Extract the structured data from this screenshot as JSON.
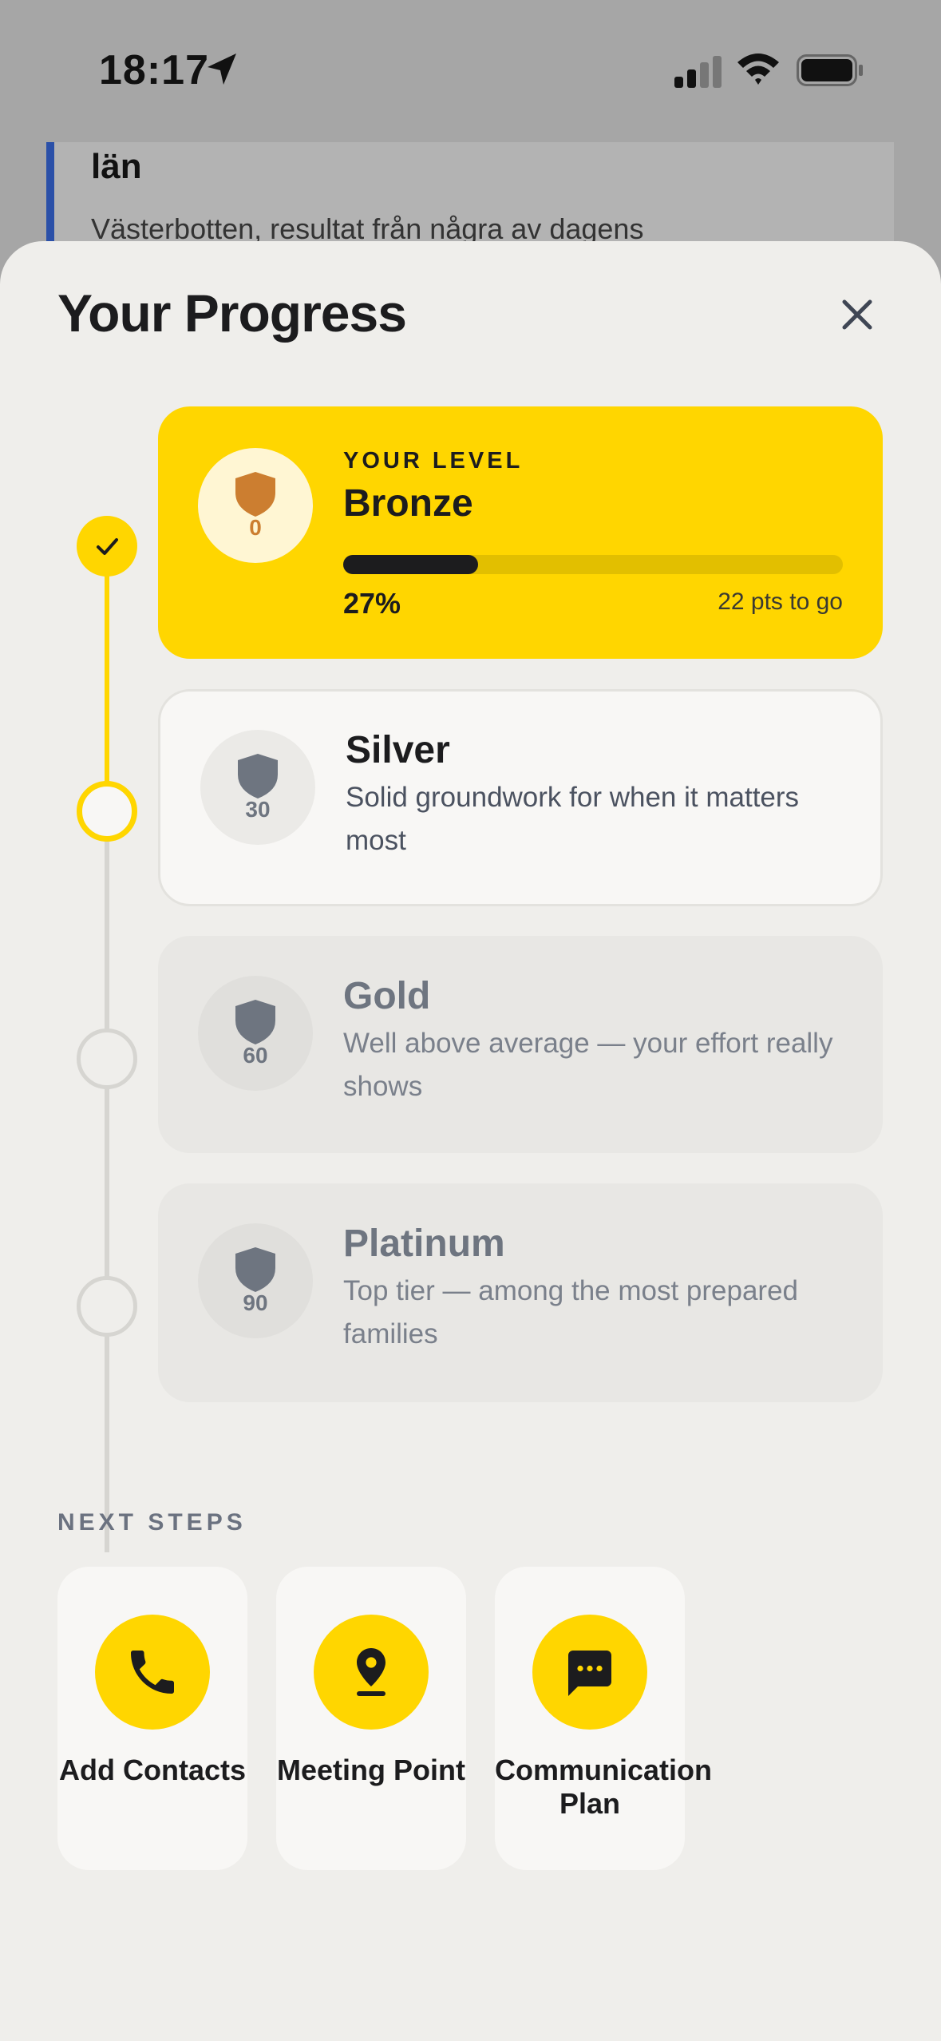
{
  "status_bar": {
    "time": "18:17"
  },
  "background_article": {
    "title": "län",
    "text": "Västerbotten, resultat från några av dagens"
  },
  "sheet": {
    "title": "Your Progress"
  },
  "levels": [
    {
      "name": "Bronze",
      "points": "0",
      "label": "YOUR LEVEL",
      "progress_percent": 27,
      "progress_text": "27%",
      "to_go": "22 pts to go",
      "state": "current"
    },
    {
      "name": "Silver",
      "points": "30",
      "description": "Solid groundwork for when it matters most",
      "state": "next"
    },
    {
      "name": "Gold",
      "points": "60",
      "description": "Well above average — your effort really shows",
      "state": "locked"
    },
    {
      "name": "Platinum",
      "points": "90",
      "description": "Top tier — among the most prepared families",
      "state": "locked"
    }
  ],
  "next_steps": {
    "label": "NEXT STEPS",
    "items": [
      {
        "label": "Add Contacts",
        "icon": "phone-icon"
      },
      {
        "label": "Meeting Point",
        "icon": "location-pin-icon"
      },
      {
        "label": "Communication Plan",
        "icon": "chat-bubble-icon"
      }
    ]
  },
  "colors": {
    "accent": "#FFD600",
    "shield_bronze": "#CC7E30",
    "shield_gray": "#6E7580",
    "sheet_bg": "#EFEEEB"
  }
}
